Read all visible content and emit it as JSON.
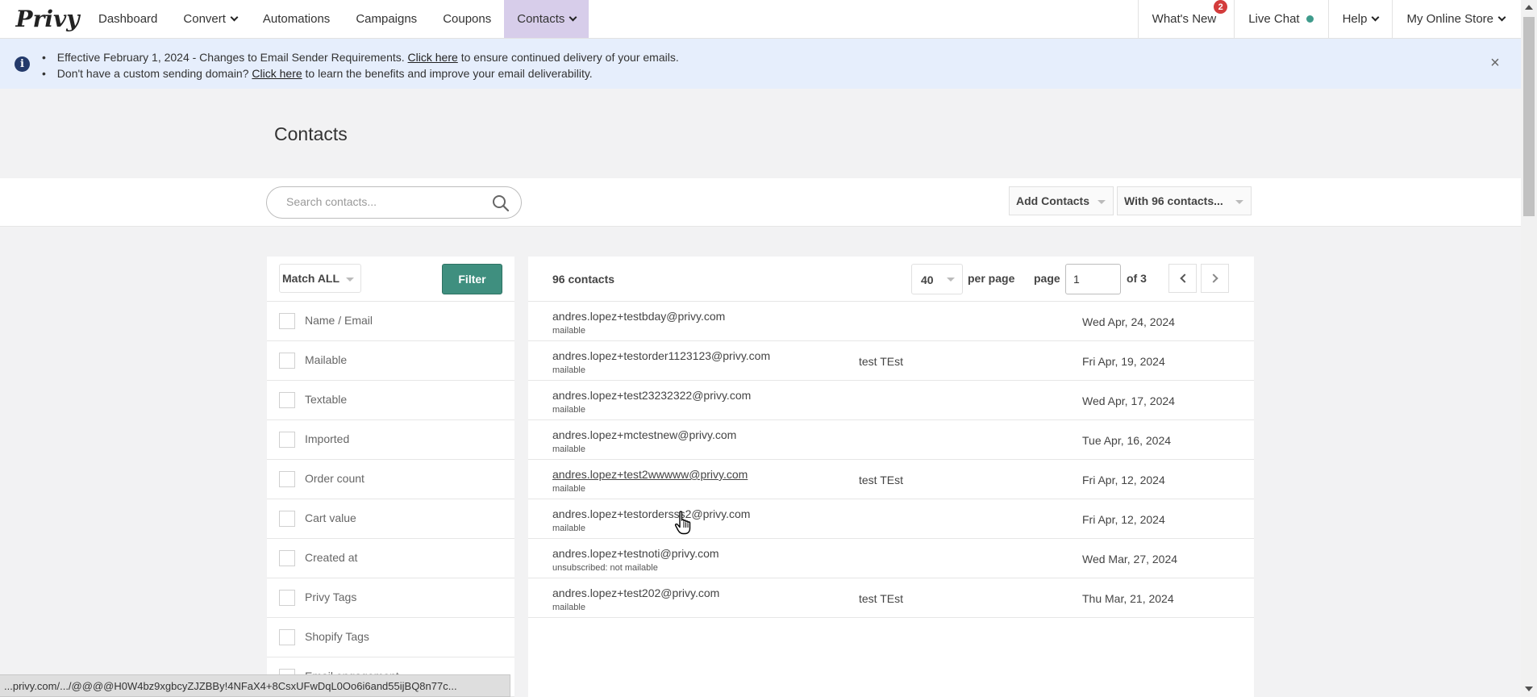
{
  "nav": {
    "logo": "Privy",
    "items": [
      {
        "label": "Dashboard"
      },
      {
        "label": "Convert"
      },
      {
        "label": "Automations"
      },
      {
        "label": "Campaigns"
      },
      {
        "label": "Coupons"
      },
      {
        "label": "Contacts"
      }
    ],
    "right": {
      "whats_new": "What's New",
      "whats_new_badge": "2",
      "live_chat": "Live Chat",
      "help": "Help",
      "store": "My Online Store"
    }
  },
  "banner": {
    "line1_text": "Effective February 1, 2024 - Changes to Email Sender Requirements.",
    "line1_link": "Click here",
    "line1_tail": "to ensure continued delivery of your emails.",
    "line2_text": "Don't have a custom sending domain?",
    "line2_link": "Click here",
    "line2_tail": "to learn the benefits and improve your email deliverability.",
    "close": "×"
  },
  "page": {
    "title": "Contacts"
  },
  "toolbar": {
    "search_placeholder": "Search contacts...",
    "add_contacts": "Add Contacts",
    "with_contacts": "With 96 contacts..."
  },
  "filters": {
    "match": "Match ALL",
    "filter_button": "Filter",
    "items": [
      {
        "label": "Name / Email"
      },
      {
        "label": "Mailable"
      },
      {
        "label": "Textable"
      },
      {
        "label": "Imported"
      },
      {
        "label": "Order count"
      },
      {
        "label": "Cart value"
      },
      {
        "label": "Created at"
      },
      {
        "label": "Privy Tags"
      },
      {
        "label": "Shopify Tags"
      },
      {
        "label": "Email engagement"
      }
    ]
  },
  "contacts": {
    "count_label": "96 contacts",
    "per_page_value": "40",
    "per_page_label": "per page",
    "page_label": "page",
    "page_value": "1",
    "of_label": "of 3",
    "rows": [
      {
        "email": "andres.lopez+testbday@privy.com",
        "status": "mailable",
        "name": "",
        "date": "Wed Apr, 24, 2024"
      },
      {
        "email": "andres.lopez+testorder1123123@privy.com",
        "status": "mailable",
        "name": "test TEst",
        "date": "Fri Apr, 19, 2024"
      },
      {
        "email": "andres.lopez+test23232322@privy.com",
        "status": "mailable",
        "name": "",
        "date": "Wed Apr, 17, 2024"
      },
      {
        "email": "andres.lopez+mctestnew@privy.com",
        "status": "mailable",
        "name": "",
        "date": "Tue Apr, 16, 2024"
      },
      {
        "email": "andres.lopez+test2wwwww@privy.com",
        "status": "mailable",
        "name": "test TEst",
        "date": "Fri Apr, 12, 2024"
      },
      {
        "email": "andres.lopez+testordersss2@privy.com",
        "status": "mailable",
        "name": "",
        "date": "Fri Apr, 12, 2024"
      },
      {
        "email": "andres.lopez+testnoti@privy.com",
        "status": "unsubscribed: not mailable",
        "name": "",
        "date": "Wed Mar, 27, 2024"
      },
      {
        "email": "andres.lopez+test202@privy.com",
        "status": "mailable",
        "name": "test TEst",
        "date": "Thu Mar, 21, 2024"
      }
    ]
  },
  "statusbar": {
    "url": "...privy.com/.../@@@@H0W4bz9xgbcyZJZBBy!4NFaX4+8CsxUFwDqL0Oo6i6and55ijBQ8n77c..."
  },
  "icons": {
    "info": "info-icon",
    "search": "search-icon",
    "close": "close-icon",
    "cursor": "hand-cursor-icon"
  },
  "colors": {
    "accent": "#3f8f7f",
    "active_nav": "#d7cdea",
    "banner": "#e6eefc",
    "badge": "#d33c3c"
  }
}
